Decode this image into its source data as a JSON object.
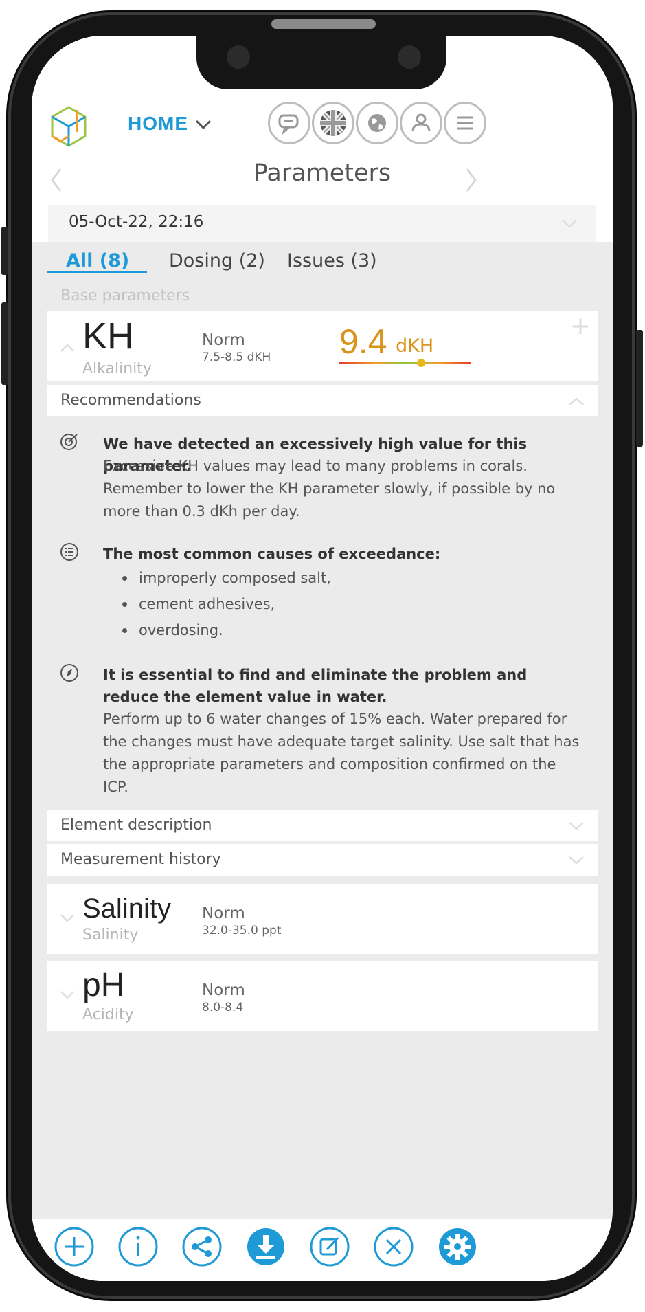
{
  "header": {
    "home_label": "HOME",
    "title": "Parameters",
    "date": "05-Oct-22, 22:16"
  },
  "tabs": [
    {
      "label": "All (8)",
      "active": true
    },
    {
      "label": "Dosing (2)",
      "active": false
    },
    {
      "label": "Issues (3)",
      "active": false
    }
  ],
  "section_caption": "Base parameters",
  "kh": {
    "name": "KH",
    "subtitle": "Alkalinity",
    "norm_label": "Norm",
    "norm_range": "7.5-8.5 dKH",
    "value": "9.4",
    "unit": "dKH",
    "gauge_position": 0.62,
    "add_symbol": "+"
  },
  "recommendations": {
    "label": "Recommendations",
    "items": [
      {
        "icon": "target-icon",
        "title": "We have detected an excessively high value for this parameter.",
        "text": "Excessive KH values may lead to many problems in corals. Remember to lower the KH parameter slowly, if possible by no more than 0.3 dKh per day."
      },
      {
        "icon": "list-icon",
        "title": "The most common causes of exceedance:",
        "bullets": [
          "improperly composed salt,",
          "cement adhesives,",
          "overdosing."
        ]
      },
      {
        "icon": "compass-icon",
        "title": "It is essential to find and eliminate the problem and reduce the element value in water.",
        "text": "Perform up to 6 water changes of 15% each. Water prepared for the changes must have adequate target salinity. Use salt that has the appropriate parameters and composition confirmed on the ICP."
      }
    ]
  },
  "element_description_label": "Element description",
  "measurement_history_label": "Measurement history",
  "salinity": {
    "name": "Salinity",
    "subtitle": "Salinity",
    "norm_label": "Norm",
    "norm_range": "32.0-35.0 ppt"
  },
  "ph": {
    "name": "pH",
    "subtitle": "Acidity",
    "norm_label": "Norm",
    "norm_range": "8.0-8.4"
  },
  "toolbar_icons": [
    "plus-icon",
    "info-icon",
    "share-icon",
    "download-icon",
    "edit-icon",
    "close-icon",
    "settings-icon"
  ],
  "colors": {
    "accent": "#1e9ad6",
    "value_warning": "#d8941b",
    "icon_gray": "#bdbdbd"
  }
}
